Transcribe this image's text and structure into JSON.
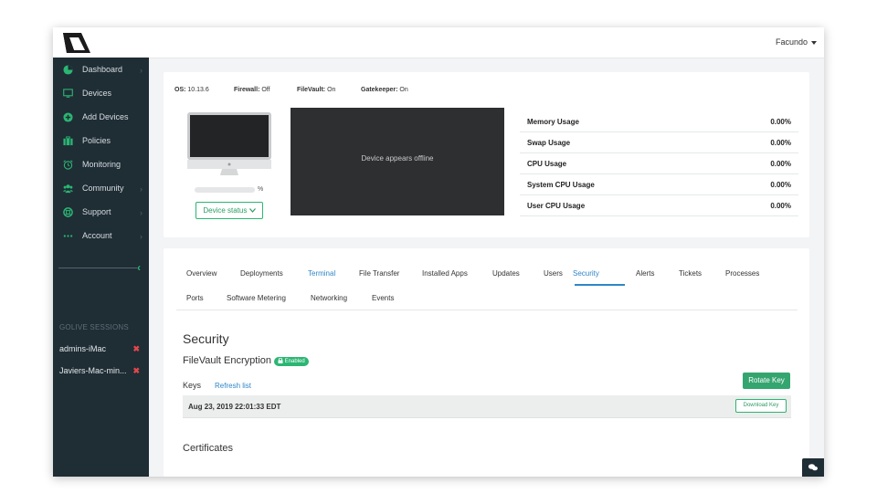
{
  "header": {
    "user_name": "Facundo"
  },
  "sidebar": {
    "items": [
      {
        "label": "Dashboard",
        "icon": "pie-chart-icon",
        "has_chevron": true
      },
      {
        "label": "Devices",
        "icon": "monitor-icon",
        "has_chevron": false
      },
      {
        "label": "Add Devices",
        "icon": "plus-circle-icon",
        "has_chevron": false
      },
      {
        "label": "Policies",
        "icon": "briefcase-icon",
        "has_chevron": false
      },
      {
        "label": "Monitoring",
        "icon": "alarm-clock-icon",
        "has_chevron": false
      },
      {
        "label": "Community",
        "icon": "users-icon",
        "has_chevron": true
      },
      {
        "label": "Support",
        "icon": "lifebuoy-icon",
        "has_chevron": true
      },
      {
        "label": "Account",
        "icon": "more-dots-icon",
        "has_chevron": true
      }
    ],
    "sessions_title": "GOLIVE SESSIONS",
    "sessions": [
      {
        "label": "admins-iMac"
      },
      {
        "label": "Javiers-Mac-min..."
      }
    ]
  },
  "device": {
    "os_label": "OS:",
    "os_value": "10.13.6",
    "firewall_label": "Firewall:",
    "firewall_value": "Off",
    "filevault_label": "FileVault:",
    "filevault_value": "On",
    "gatekeeper_label": "Gatekeeper:",
    "gatekeeper_value": "On",
    "progress_suffix": "%",
    "progress_fraction": 0,
    "status_button": "Device status",
    "screen_message": "Device appears offline"
  },
  "usage": [
    {
      "label": "Memory Usage",
      "value": "0.00%"
    },
    {
      "label": "Swap Usage",
      "value": "0.00%"
    },
    {
      "label": "CPU Usage",
      "value": "0.00%"
    },
    {
      "label": "System CPU Usage",
      "value": "0.00%"
    },
    {
      "label": "User CPU Usage",
      "value": "0.00%"
    }
  ],
  "tabs": {
    "row1": [
      "Overview",
      "Deployments",
      "Terminal",
      "File Transfer",
      "Installed Apps",
      "Updates",
      "Users",
      "Security",
      "Alerts",
      "Tickets",
      "Processes"
    ],
    "row2": [
      "Ports",
      "Software Metering",
      "Networking",
      "Events"
    ],
    "active": "Security"
  },
  "security": {
    "title": "Security",
    "filevault_heading": "FileVault Encryption",
    "enabled_badge": "Enabled",
    "keys_label": "Keys",
    "refresh_link": "Refresh list",
    "rotate_button": "Rotate Key",
    "key_date": "Aug 23, 2019 22:01:33 EDT",
    "download_button": "Download Key",
    "certificates_heading": "Certificates"
  },
  "colors": {
    "accent_green": "#2bb673",
    "accent_blue": "#2f86c7",
    "sidebar_bg": "#1f2d35",
    "danger": "#e2474b"
  }
}
